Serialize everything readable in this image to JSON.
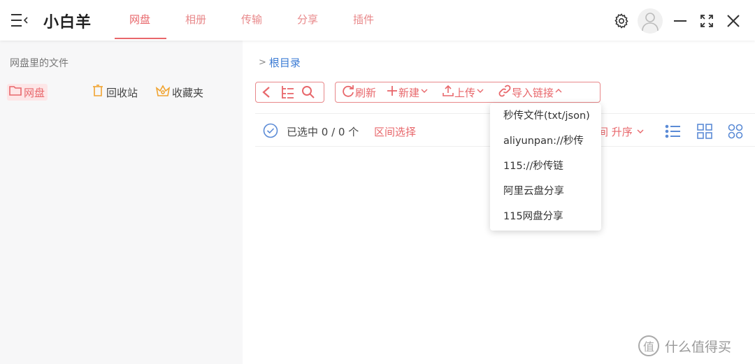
{
  "app": {
    "title": "小白羊"
  },
  "nav": {
    "tabs": [
      "网盘",
      "相册",
      "传输",
      "分享",
      "插件"
    ],
    "active": "网盘"
  },
  "sidebar": {
    "heading": "网盘里的文件",
    "items": [
      {
        "label": "网盘",
        "icon": "folder-icon"
      },
      {
        "label": "回收站",
        "icon": "trash-icon"
      },
      {
        "label": "收藏夹",
        "icon": "crown-icon"
      }
    ]
  },
  "breadcrumb": {
    "separator": ">",
    "root": "根目录"
  },
  "toolbar": {
    "refresh": "刷新",
    "new": "新建",
    "upload": "上传",
    "import_link": "导入链接"
  },
  "selection": {
    "text": "已选中 0 / 0 个",
    "range_select": "区间选择"
  },
  "sort": {
    "label": "间 升序"
  },
  "import_menu": {
    "items": [
      "秒传文件(txt/json)",
      "aliyunpan://秒传",
      "115://秒传链",
      "阿里云盘分享",
      "115网盘分享"
    ]
  },
  "watermark": {
    "text": "什么值得买",
    "logo": "值"
  },
  "colors": {
    "accent": "#e8676b",
    "link": "#3b7bd4",
    "icon_blue": "#5b8bd6",
    "icon_orange": "#f0a431"
  }
}
